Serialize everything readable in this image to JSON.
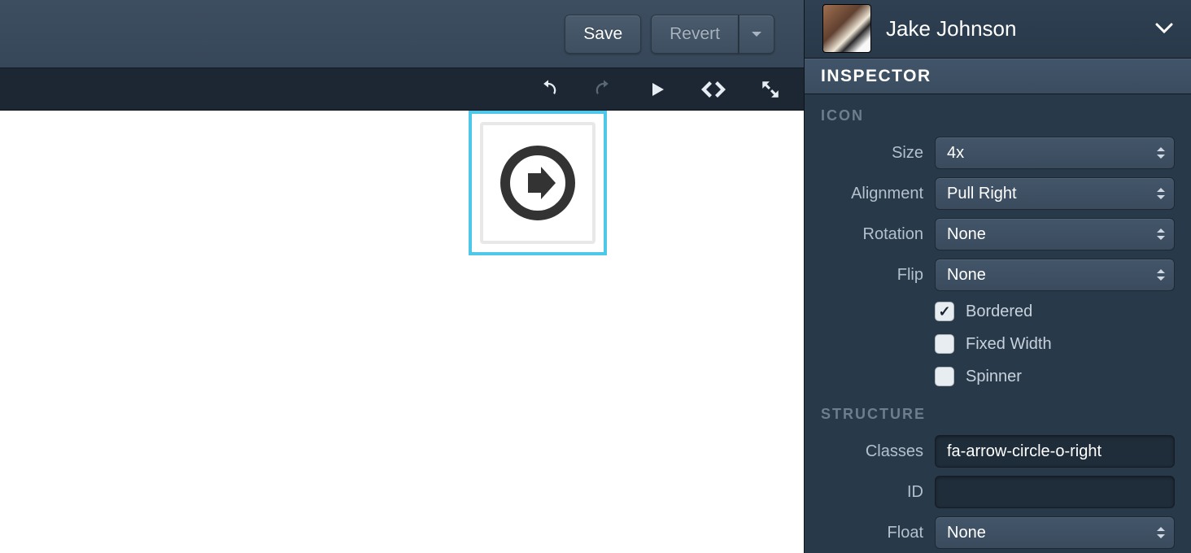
{
  "toolbar": {
    "save_label": "Save",
    "revert_label": "Revert"
  },
  "user": {
    "name": "Jake Johnson"
  },
  "inspector": {
    "title": "INSPECTOR",
    "sections": {
      "icon": {
        "label": "ICON",
        "size_label": "Size",
        "size_value": "4x",
        "alignment_label": "Alignment",
        "alignment_value": "Pull Right",
        "rotation_label": "Rotation",
        "rotation_value": "None",
        "flip_label": "Flip",
        "flip_value": "None",
        "bordered_label": "Bordered",
        "bordered_checked": true,
        "fixed_width_label": "Fixed Width",
        "fixed_width_checked": false,
        "spinner_label": "Spinner",
        "spinner_checked": false
      },
      "structure": {
        "label": "STRUCTURE",
        "classes_label": "Classes",
        "classes_value": "fa-arrow-circle-o-right",
        "id_label": "ID",
        "id_value": "",
        "float_label": "Float",
        "float_value": "None"
      }
    }
  }
}
